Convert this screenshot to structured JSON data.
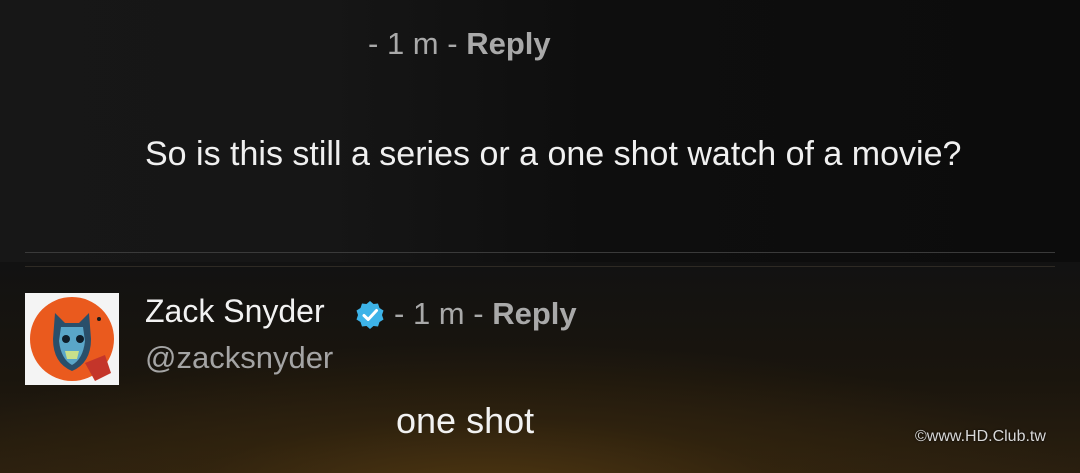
{
  "top_comment": {
    "time_separator_prefix": "- ",
    "time": "1 m",
    "time_separator_suffix": " - ",
    "reply_label": "Reply",
    "text": "So is this still a series or a one shot watch of a movie?"
  },
  "reply_comment": {
    "username": "Zack Snyder",
    "verified_icon": "verified-badge-icon",
    "time_separator_prefix": "- ",
    "time": "1 m",
    "time_separator_suffix": " - ",
    "reply_label": "Reply",
    "handle": "@zacksnyder",
    "text": "one shot"
  },
  "watermark": "©www.HD.Club.tw",
  "colors": {
    "verified_badge": "#3db3e8",
    "meta_text": "#a9a9a9",
    "body_text": "#f0f0f0"
  }
}
